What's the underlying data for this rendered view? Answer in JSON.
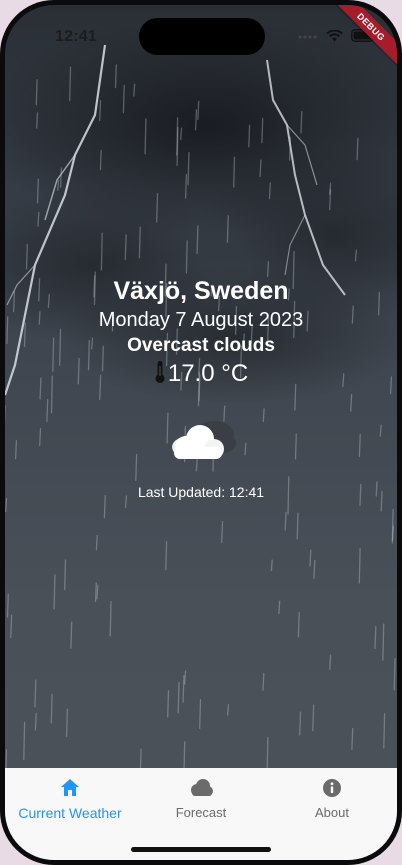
{
  "status_bar": {
    "time": "12:41",
    "debug_label": "DEBUG"
  },
  "weather": {
    "location": "Växjö, Sweden",
    "date": "Monday 7 August 2023",
    "description": "Overcast clouds",
    "temperature": "17.0 °C",
    "condition_icon": "cloud-icon",
    "last_updated": "Last Updated: 12:41"
  },
  "bottom_nav": {
    "items": [
      {
        "label": "Current Weather",
        "icon": "home-icon",
        "active": true
      },
      {
        "label": "Forecast",
        "icon": "cloud-icon",
        "active": false
      },
      {
        "label": "About",
        "icon": "info-icon",
        "active": false
      }
    ]
  },
  "colors": {
    "accent": "#2196f3",
    "inactive": "#6b6b6b",
    "nav_background": "#f8f8f9",
    "debug_banner": "#a51c2a"
  }
}
